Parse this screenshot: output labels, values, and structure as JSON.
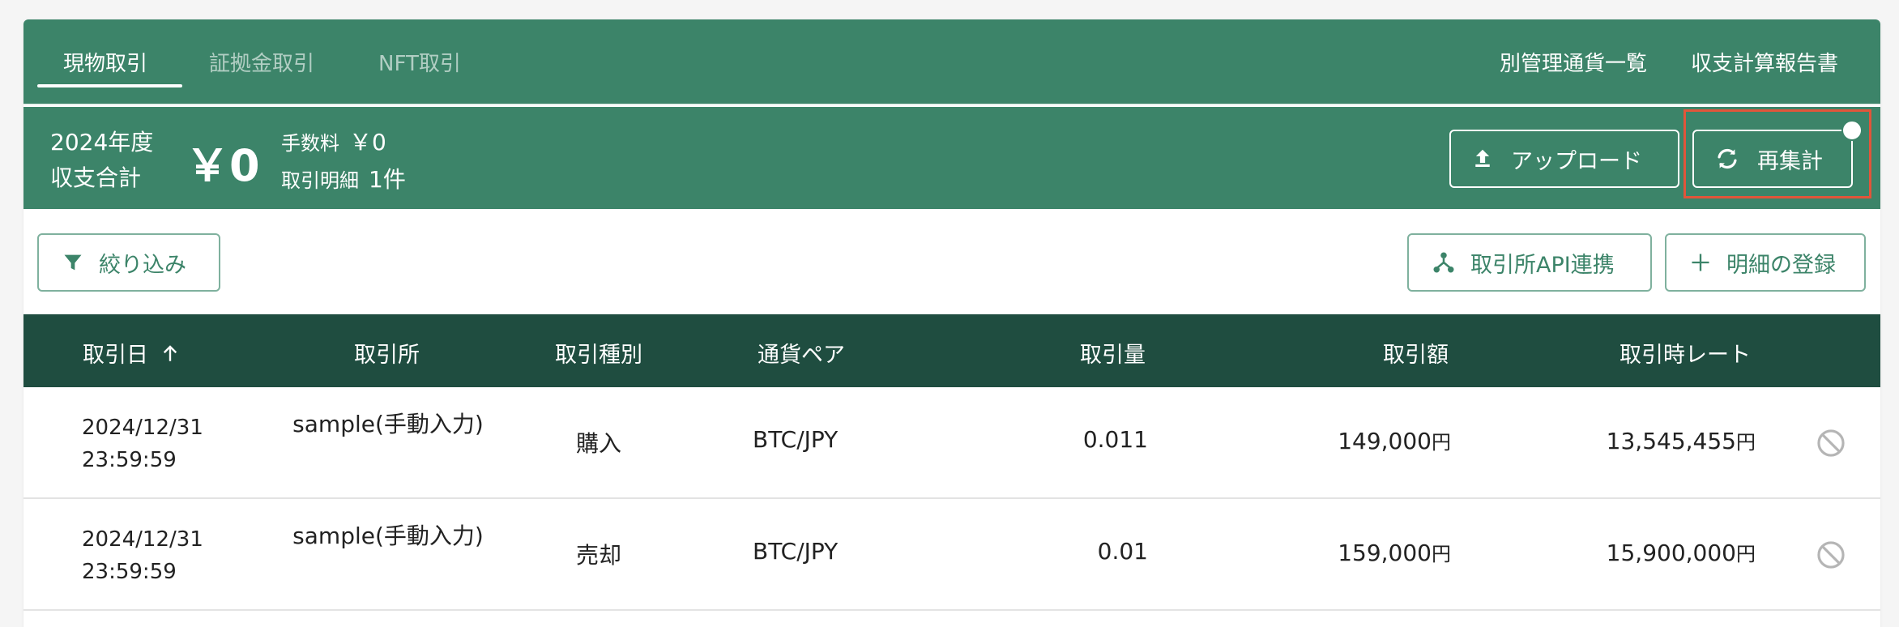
{
  "tabs": [
    {
      "label": "現物取引",
      "active": true
    },
    {
      "label": "証拠金取引",
      "active": false
    },
    {
      "label": "NFT取引",
      "active": false
    }
  ],
  "header_links": {
    "currency_list": "別管理通貨一覧",
    "report": "収支計算報告書"
  },
  "summary": {
    "fiscal_year": "2024年度",
    "total_label": "収支合計",
    "total_value": "￥0",
    "fee_label": "手数料",
    "fee_value": "￥0",
    "detail_label": "取引明細",
    "detail_value": "1件"
  },
  "actions": {
    "upload": "アップロード",
    "recalc": "再集計",
    "filter": "絞り込み",
    "api": "取引所API連携",
    "add": "明細の登録"
  },
  "table": {
    "columns": {
      "date": "取引日",
      "exchange": "取引所",
      "type": "取引種別",
      "pair": "通貨ペア",
      "qty": "取引量",
      "amount": "取引額",
      "rate": "取引時レート"
    },
    "yen_unit": "円",
    "rows": [
      {
        "date": "2024/12/31",
        "time": "23:59:59",
        "exchange": "sample(手動入力)",
        "type": "購入",
        "pair": "BTC/JPY",
        "qty": "0.011",
        "amount": "149,000",
        "rate": "13,545,455"
      },
      {
        "date": "2024/12/31",
        "time": "23:59:59",
        "exchange": "sample(手動入力)",
        "type": "売却",
        "pair": "BTC/JPY",
        "qty": "0.01",
        "amount": "159,000",
        "rate": "15,900,000"
      }
    ]
  },
  "colors": {
    "brand": "#3c8469",
    "header_dark": "#1f4d40",
    "highlight": "#e2553a"
  }
}
